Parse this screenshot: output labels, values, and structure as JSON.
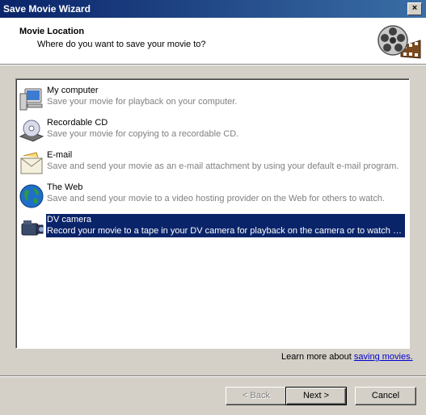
{
  "window": {
    "title": "Save Movie Wizard",
    "close": "×"
  },
  "header": {
    "title": "Movie Location",
    "subtitle": "Where do you want to save your movie to?"
  },
  "options": [
    {
      "name": "My computer",
      "desc": "Save your movie for playback on your computer.",
      "icon": "computer-icon"
    },
    {
      "name": "Recordable CD",
      "desc": "Save your movie for copying to a recordable CD.",
      "icon": "cd-icon"
    },
    {
      "name": "E-mail",
      "desc": "Save and send your movie as an e-mail attachment by using your default e-mail program.",
      "icon": "email-icon"
    },
    {
      "name": "The Web",
      "desc": "Save and send your movie to a video hosting provider on the Web for others to watch.",
      "icon": "globe-icon"
    },
    {
      "name": "DV camera",
      "desc": "Record your movie to a tape in your DV camera for playback on the camera or to watch o...",
      "icon": "dv-camera-icon"
    }
  ],
  "selected_option": "DV camera",
  "learn_more": {
    "prefix": "Learn more about ",
    "link": "saving movies."
  },
  "buttons": {
    "back": "< Back",
    "next": "Next >",
    "cancel": "Cancel"
  },
  "colors": {
    "selection": "#0a246a",
    "link": "#0000cc",
    "desc_text": "#808080"
  }
}
